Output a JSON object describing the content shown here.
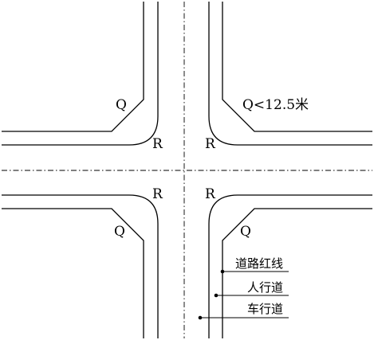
{
  "labels": {
    "q_top_left": "Q",
    "q_top_right": "Q<12.5米",
    "r_top_left": "R",
    "r_top_right": "R",
    "r_bottom_left": "R",
    "r_bottom_right": "R",
    "q_bottom_left": "Q",
    "q_bottom_right": "Q"
  },
  "legend": {
    "road_red_line": "道路红线",
    "sidewalk": "人行道",
    "carriageway": "车行道"
  },
  "colors": {
    "line": "#000000",
    "background": "#ffffff"
  }
}
